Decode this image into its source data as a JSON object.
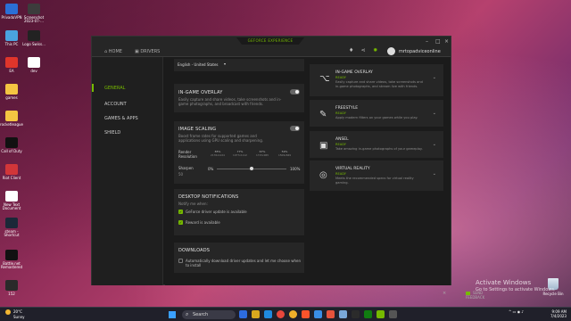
{
  "desktop": {
    "icons": [
      {
        "label": "PrivadoVPN",
        "color": "#2b6fd6"
      },
      {
        "label": "Screenshot 2023-07-...",
        "color": "#3c3c3c"
      },
      {
        "label": "This PC",
        "color": "#4aa3df"
      },
      {
        "label": "Logo Swiss...",
        "color": "#222222"
      },
      {
        "label": "EA",
        "color": "#e0352b"
      },
      {
        "label": "dev",
        "color": "#ffffff"
      },
      {
        "label": "games",
        "color": "#f4c542"
      },
      {
        "label": "rocketleague",
        "color": "#f4c542"
      },
      {
        "label": "Call of Duty",
        "color": "#111111"
      },
      {
        "label": "Riot Client",
        "color": "#d13639"
      },
      {
        "label": "New Text Document",
        "color": "#ffffff"
      },
      {
        "label": "steam - Shortcut",
        "color": "#1b2838"
      },
      {
        "label": "Battle.net Remastered",
        "color": "#111111"
      },
      {
        "label": "152",
        "color": "#2a2a2a"
      }
    ],
    "recycle_bin": "Recycle Bin",
    "activate_title": "Activate Windows",
    "activate_sub": "Go to Settings to activate Windows."
  },
  "app": {
    "brand": "GEFORCE EXPERIENCE",
    "nav": {
      "home": "HOME",
      "drivers": "DRIVERS"
    },
    "user": "mrtopadviceonline",
    "sidebar": [
      {
        "label": "GENERAL",
        "active": true
      },
      {
        "label": "ACCOUNT",
        "active": false
      },
      {
        "label": "GAMES & APPS",
        "active": false
      },
      {
        "label": "SHIELD",
        "active": false
      }
    ],
    "language": "English - United States",
    "overlay_card": {
      "title": "IN-GAME OVERLAY",
      "desc": "Easily capture and share videos, take screenshots and in-game photographs, and broadcast with friends."
    },
    "scaling_card": {
      "title": "IMAGE SCALING",
      "desc": "Boost frame rates for supported games and applications using GPU scaling and sharpening.",
      "render_label": "Render Resolution",
      "resolutions": [
        {
          "pct": "85%",
          "res": "2176x1224"
        },
        {
          "pct": "77%",
          "res": "1977x1112"
        },
        {
          "pct": "67%",
          "res": "1715x965"
        },
        {
          "pct": "59%",
          "res": "1509x849"
        }
      ],
      "sharpen_label": "Sharpen",
      "sharpen_sub": "50",
      "sharpen_min": "0%",
      "sharpen_max": "100%",
      "sharpen_value": 0.5
    },
    "notifications_card": {
      "title": "DESKTOP NOTIFICATIONS",
      "sub": "Notify me when:",
      "items": [
        {
          "label": "GeForce driver update is available",
          "checked": true
        },
        {
          "label": "Reward is available",
          "checked": true
        }
      ]
    },
    "downloads_card": {
      "title": "DOWNLOADS",
      "item": "Automatically download driver updates and let me choose when to install"
    },
    "features": [
      {
        "icon": "share-icon",
        "glyph": "⌥",
        "title": "IN-GAME OVERLAY",
        "status": "READY",
        "desc": "Easily capture and share videos, take screenshots and in-game photographs, and stream live with friends."
      },
      {
        "icon": "freestyle-icon",
        "glyph": "✎",
        "title": "FREESTYLE",
        "status": "READY",
        "desc": "Apply modern filters on your games while you play."
      },
      {
        "icon": "camera-icon",
        "glyph": "▣",
        "title": "ANSEL",
        "status": "READY",
        "desc": "Take amazing in-game photographs of your gameplay."
      },
      {
        "icon": "vr-icon",
        "glyph": "◎",
        "title": "VIRTUAL REALITY",
        "status": "READY",
        "desc": "Meets the recommended specs for virtual reality gaming."
      }
    ],
    "feedback": "SEND FEEDBACK"
  },
  "taskbar": {
    "temp": "20°C",
    "condition": "Sunny",
    "search": "Search",
    "time": "9:09 AM",
    "date": "7/4/2023"
  }
}
